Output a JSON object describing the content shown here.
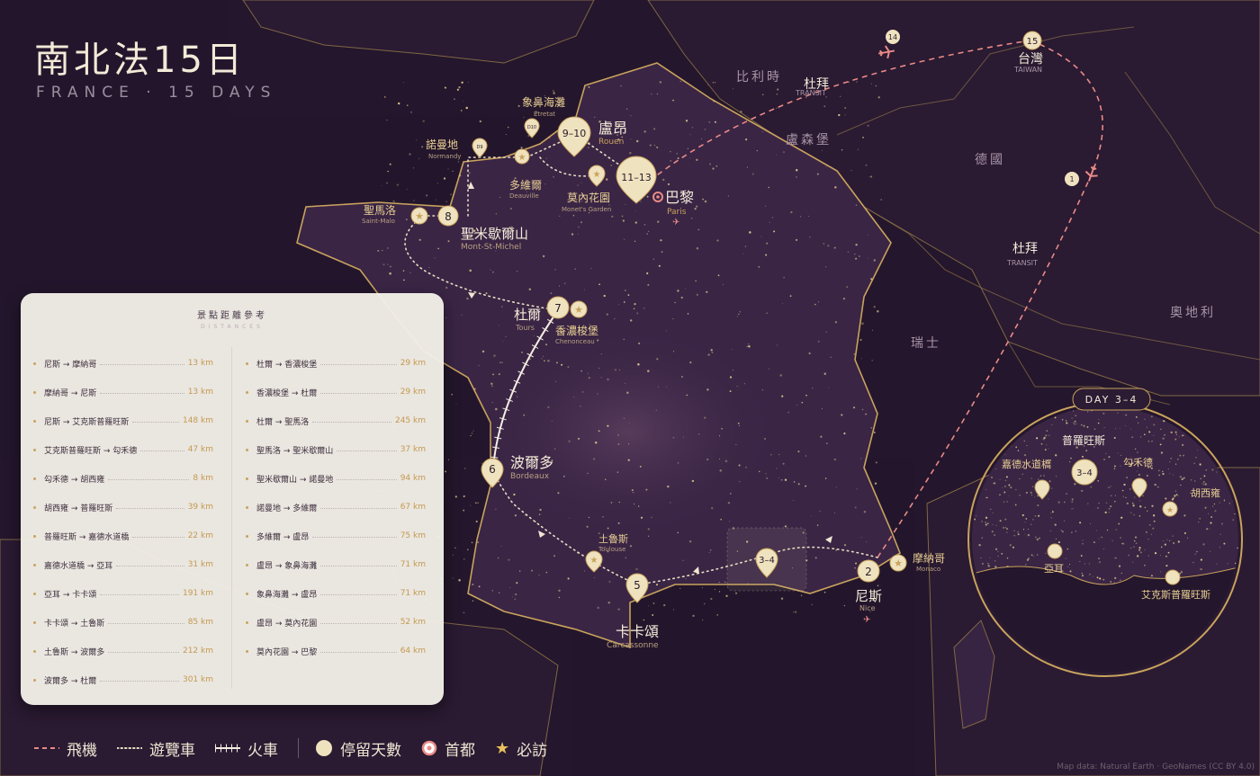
{
  "title": "南北法15日",
  "subtitle": "FRANCE · 15 DAYS",
  "countries": [
    "比利時",
    "盧森堡",
    "德國",
    "瑞士",
    "奧地利"
  ],
  "transit_top": {
    "name": "杜拜",
    "en": "TRANSIT"
  },
  "transit_bottom": {
    "name": "杜拜",
    "en": "TRANSIT"
  },
  "taiwan": {
    "name": "台灣",
    "en": "TAIWAN",
    "day": "15"
  },
  "flight_marker_14": "14",
  "flight_marker_1": "1",
  "cities": {
    "rouen": {
      "name": "盧昂",
      "en": "Rouen",
      "days": "9–10"
    },
    "paris": {
      "name": "巴黎",
      "en": "Paris",
      "days": "11–13"
    },
    "etretat": {
      "name": "象鼻海灘",
      "en": "Étretat",
      "tag": "D10"
    },
    "normandy": {
      "name": "諾曼地",
      "en": "Normandy",
      "tag": "D9"
    },
    "deauville": {
      "name": "多維爾",
      "en": "Deauville"
    },
    "giverny": {
      "name": "莫內花園",
      "en": "Monet's Garden"
    },
    "stmalo": {
      "name": "聖馬洛",
      "en": "Saint-Malo",
      "day": "8"
    },
    "montstmichel": {
      "name": "聖米歇爾山",
      "en": "Mont-St-Michel"
    },
    "tours": {
      "name": "杜爾",
      "en": "Tours",
      "day": "7"
    },
    "chenonceau": {
      "name": "香濃梭堡",
      "en": "Chenonceau"
    },
    "bordeaux": {
      "name": "波爾多",
      "en": "Bordeaux",
      "day": "6"
    },
    "toulouse": {
      "name": "土魯斯",
      "en": "Toulouse"
    },
    "carcassonne": {
      "name": "卡卡頌",
      "en": "Carcassonne",
      "day": "5"
    },
    "provence": {
      "days": "3–4"
    },
    "nice": {
      "name": "尼斯",
      "en": "Nice",
      "day": "2"
    },
    "monaco": {
      "name": "摩納哥",
      "en": "Monaco"
    }
  },
  "inset": {
    "title": "DAY 3–4",
    "region": "普羅旺斯",
    "days": "3–4",
    "places": {
      "gordes": "普羅旺斯",
      "roussillon": "嘉德水道橋",
      "luberon": "勾禾德",
      "avignon": "胡西雍",
      "arles": "亞耳",
      "aix": "艾克斯普羅旺斯"
    }
  },
  "distance_panel": {
    "title": "景點距離參考",
    "subtitle": "DISTANCES",
    "left": [
      {
        "route": "尼斯 → 摩納哥",
        "km": "13 km"
      },
      {
        "route": "摩納哥 → 尼斯",
        "km": "13 km"
      },
      {
        "route": "尼斯 → 艾克斯普羅旺斯",
        "km": "148 km"
      },
      {
        "route": "艾克斯普羅旺斯 → 勾禾德",
        "km": "47 km"
      },
      {
        "route": "勾禾德 → 胡西雍",
        "km": "8 km"
      },
      {
        "route": "胡西雍 → 普羅旺斯",
        "km": "39 km"
      },
      {
        "route": "普羅旺斯 → 嘉德水道橋",
        "km": "22 km"
      },
      {
        "route": "嘉德水道橋 → 亞耳",
        "km": "31 km"
      },
      {
        "route": "亞耳 → 卡卡頌",
        "km": "191 km"
      },
      {
        "route": "卡卡頌 → 土魯斯",
        "km": "85 km"
      },
      {
        "route": "土魯斯 → 波爾多",
        "km": "212 km"
      },
      {
        "route": "波爾多 → 杜爾",
        "km": "301 km"
      }
    ],
    "right": [
      {
        "route": "杜爾 → 香濃梭堡",
        "km": "29 km"
      },
      {
        "route": "香濃梭堡 → 杜爾",
        "km": "29 km"
      },
      {
        "route": "杜爾 → 聖馬洛",
        "km": "245 km"
      },
      {
        "route": "聖馬洛 → 聖米歇爾山",
        "km": "37 km"
      },
      {
        "route": "聖米歇爾山 → 諾曼地",
        "km": "94 km"
      },
      {
        "route": "諾曼地 → 多維爾",
        "km": "67 km"
      },
      {
        "route": "多維爾 → 盧昂",
        "km": "75 km"
      },
      {
        "route": "盧昂 → 象鼻海灘",
        "km": "71 km"
      },
      {
        "route": "象鼻海灘 → 盧昂",
        "km": "71 km"
      },
      {
        "route": "盧昂 → 莫內花園",
        "km": "52 km"
      },
      {
        "route": "莫內花園 → 巴黎",
        "km": "64 km"
      }
    ]
  },
  "legend": {
    "flight": "飛機",
    "bus": "遊覽車",
    "train": "火車",
    "stay": "停留天數",
    "capital": "首都",
    "must": "必訪"
  },
  "credit": "Map data: Natural Earth · GeoNames (CC BY 4.0)",
  "colors": {
    "background": "#24162c",
    "land_france": "#3a2545",
    "border": "#c9a35c",
    "gold": "#e8cf93",
    "flight": "#e98a86",
    "marker": "#efe2bf"
  }
}
